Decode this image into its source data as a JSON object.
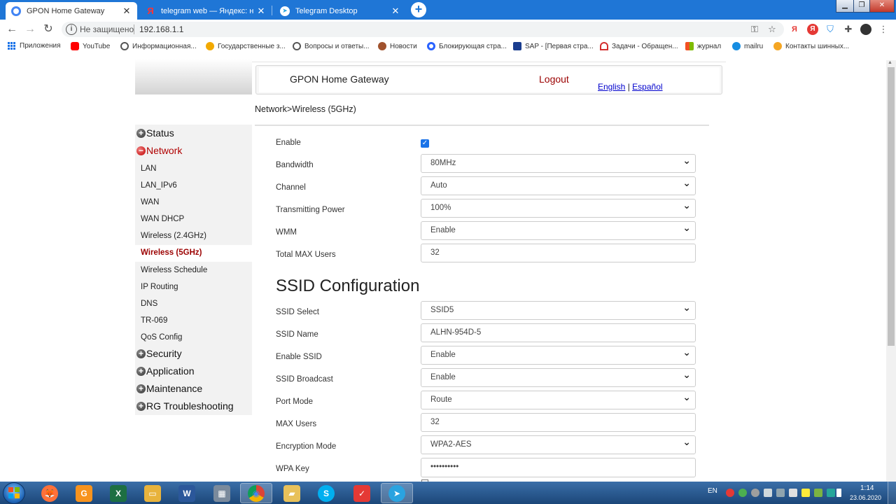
{
  "browser": {
    "tabs": [
      {
        "title": "GPON Home Gateway",
        "icon": "chrome-icon",
        "active": true
      },
      {
        "title": "telegram web — Яндекс: нашлось",
        "icon": "yandex-icon",
        "active": false
      },
      {
        "title": "Telegram Desktop",
        "icon": "telegram-icon",
        "active": false
      }
    ],
    "new_tab_symbol": "+",
    "window_controls": {
      "minimize": "▁",
      "maximize": "❐",
      "close": "✕"
    },
    "address": {
      "security_label": "Не защищено",
      "url": "192.168.1.1"
    },
    "bookmarks": [
      {
        "label": "Приложения",
        "icon": "apps-icon"
      },
      {
        "label": "YouTube",
        "icon": "youtube-icon",
        "color": "#ff0000"
      },
      {
        "label": "Информационная...",
        "icon": "globe-icon",
        "color": "#555555"
      },
      {
        "label": "Государственные з...",
        "icon": "pencil-icon",
        "color": "#f2a900"
      },
      {
        "label": "Вопросы и ответы...",
        "icon": "globe-icon",
        "color": "#555555"
      },
      {
        "label": "Новости",
        "icon": "news-icon",
        "color": "#a0522d"
      },
      {
        "label": "Блокирующая стра...",
        "icon": "eye-icon",
        "color": "#2962ff"
      },
      {
        "label": "SAP - [Первая стра...",
        "icon": "sap-icon",
        "color": "#1a3d8f"
      },
      {
        "label": "Задачи - Обращен...",
        "icon": "loop-icon",
        "color": "#d32f2f"
      },
      {
        "label": "журнал",
        "icon": "windows-icon",
        "color": "#f25022"
      },
      {
        "label": "mailru",
        "icon": "mail-icon",
        "color": "#168de2"
      },
      {
        "label": "Контакты шинных...",
        "icon": "tyre-icon",
        "color": "#f5a623"
      }
    ]
  },
  "page": {
    "header_title": "GPON Home Gateway",
    "logout": "Logout",
    "lang_english": "English",
    "lang_sep": "|",
    "lang_spanish": "Español",
    "breadcrumb": "Network>Wireless (5GHz)"
  },
  "sidebar": {
    "menus": [
      {
        "label": "Status",
        "open": false,
        "symbol": "+"
      },
      {
        "label": "Network",
        "open": true,
        "symbol": "−"
      },
      {
        "label": "Security",
        "open": false,
        "symbol": "+"
      },
      {
        "label": "Application",
        "open": false,
        "symbol": "+"
      },
      {
        "label": "Maintenance",
        "open": false,
        "symbol": "+"
      },
      {
        "label": "RG Troubleshooting",
        "open": false,
        "symbol": "+"
      }
    ],
    "network_items": [
      "LAN",
      "LAN_IPv6",
      "WAN",
      "WAN DHCP",
      "Wireless (2.4GHz)",
      "Wireless (5GHz)",
      "Wireless Schedule",
      "IP Routing",
      "DNS",
      "TR-069",
      "QoS Config"
    ],
    "active_item": "Wireless (5GHz)"
  },
  "wireless": {
    "enable": {
      "label": "Enable",
      "checked": true,
      "check_symbol": "✓"
    },
    "fields": [
      {
        "label": "Bandwidth",
        "value": "80MHz",
        "type": "select"
      },
      {
        "label": "Channel",
        "value": "Auto",
        "type": "select"
      },
      {
        "label": "Transmitting Power",
        "value": "100%",
        "type": "select"
      },
      {
        "label": "WMM",
        "value": "Enable",
        "type": "select"
      },
      {
        "label": "Total MAX Users",
        "value": "32",
        "type": "input"
      }
    ]
  },
  "ssid": {
    "heading": "SSID Configuration",
    "fields": [
      {
        "label": "SSID Select",
        "value": "SSID5",
        "type": "select"
      },
      {
        "label": "SSID Name",
        "value": "ALHN-954D-5",
        "type": "input"
      },
      {
        "label": "Enable SSID",
        "value": "Enable",
        "type": "select"
      },
      {
        "label": "SSID Broadcast",
        "value": "Enable",
        "type": "select"
      },
      {
        "label": "Port Mode",
        "value": "Route",
        "type": "select"
      },
      {
        "label": "MAX Users",
        "value": "32",
        "type": "input"
      },
      {
        "label": "Encryption Mode",
        "value": "WPA2-AES",
        "type": "select"
      },
      {
        "label": "WPA Key",
        "value": "••••••••••",
        "type": "input"
      }
    ]
  },
  "taskbar": {
    "apps": [
      {
        "name": "firefox-icon",
        "glyph": "🦊",
        "color": "#ff7139",
        "running": false
      },
      {
        "name": "pdf-icon",
        "glyph": "G",
        "color": "#f7931e",
        "running": false
      },
      {
        "name": "excel-icon",
        "glyph": "X",
        "color": "#1d6f42",
        "running": false
      },
      {
        "name": "explorer-icon",
        "glyph": "▭",
        "color": "#e8b33c",
        "running": false
      },
      {
        "name": "word-icon",
        "glyph": "W",
        "color": "#2b579a",
        "running": false
      },
      {
        "name": "calculator-icon",
        "glyph": "▦",
        "color": "#7a8a9c",
        "running": false
      },
      {
        "name": "chrome-icon",
        "glyph": "◉",
        "color": "#db4437",
        "running": true
      },
      {
        "name": "folder-icon",
        "glyph": "▰",
        "color": "#e8c15a",
        "running": false
      },
      {
        "name": "skype-icon",
        "glyph": "S",
        "color": "#00aff0",
        "running": false
      },
      {
        "name": "shield-icon",
        "glyph": "✓",
        "color": "#e53935",
        "running": false
      },
      {
        "name": "telegram-icon",
        "glyph": "➤",
        "color": "#2aa3e0",
        "running": true
      }
    ],
    "tray_lang": "EN",
    "time": "1:14",
    "date": "23.06.2020"
  },
  "colors": {
    "chrome_blue": "#1f76d6",
    "nav_active": "#9b0000",
    "link": "#0000cc",
    "checkbox": "#1a73e8"
  }
}
